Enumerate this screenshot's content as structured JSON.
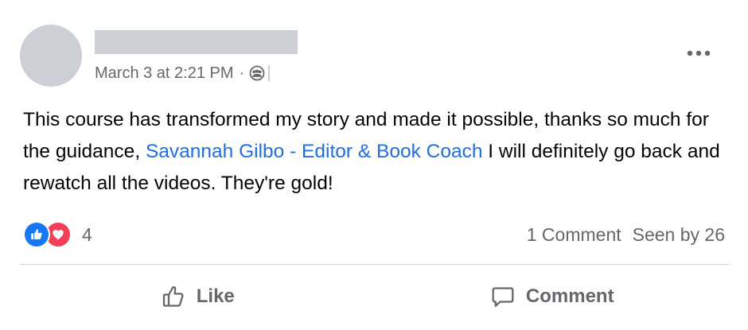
{
  "post": {
    "timestamp": "March 3 at 2:21 PM",
    "separator": "·",
    "audience_icon": "group-icon",
    "text_before": "This course has transformed my story and made it possible, thanks so much for the guidance, ",
    "mention": "Savannah Gilbo - Editor & Book Coach",
    "text_after": " I will definitely go back and rewatch all the videos. They're gold!"
  },
  "reactions": {
    "icons": [
      "like-reaction-icon",
      "love-reaction-icon"
    ],
    "count": "4"
  },
  "stats": {
    "comments": "1 Comment",
    "seen": "Seen by 26"
  },
  "actions": {
    "like_label": "Like",
    "comment_label": "Comment"
  },
  "colors": {
    "link": "#216fdb",
    "secondary_text": "#65676b",
    "like_blue": "#1877f2",
    "love_red": "#f33e58",
    "placeholder_gray": "#ccd0d6"
  }
}
